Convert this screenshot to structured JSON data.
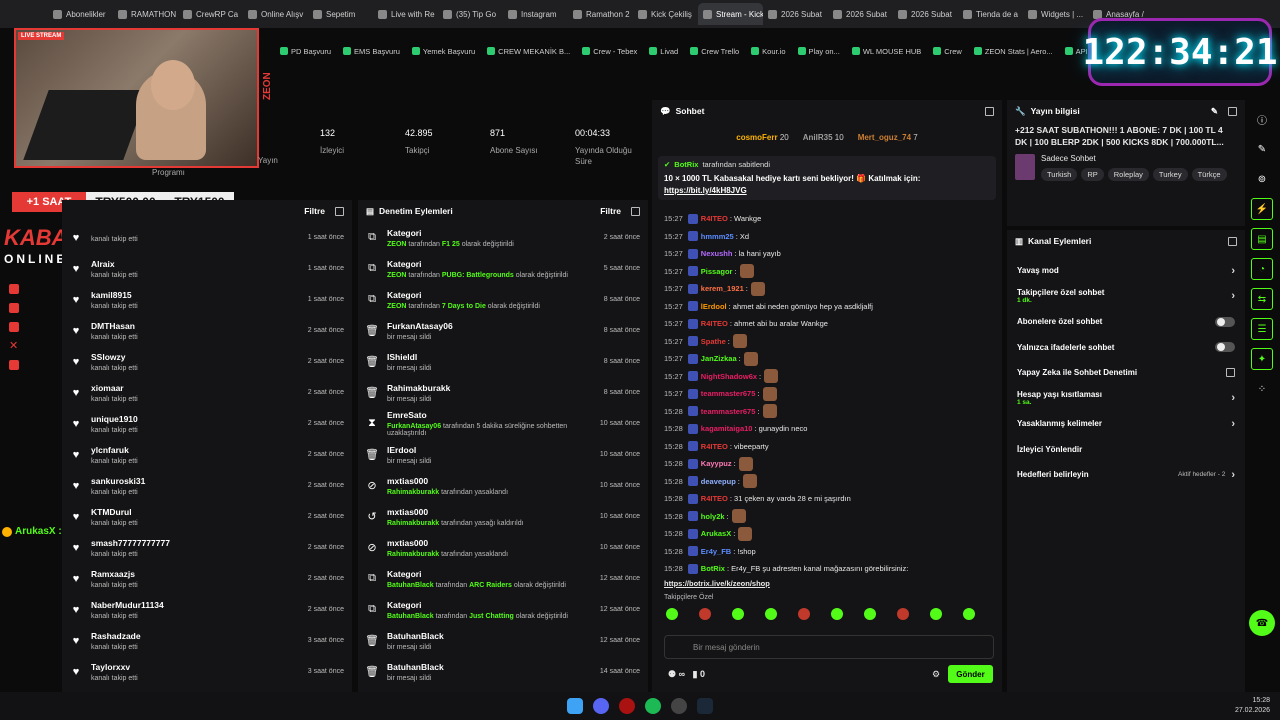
{
  "browser": {
    "tabs": [
      {
        "label": "Abonelikler",
        "active": false
      },
      {
        "label": "RAMATHON",
        "active": false
      },
      {
        "label": "CrewRP Ca",
        "active": false
      },
      {
        "label": "Online Alışv",
        "active": false
      },
      {
        "label": "Sepetim",
        "active": false
      },
      {
        "label": "Live with Re",
        "active": false
      },
      {
        "label": "(35) Tip Go",
        "active": false
      },
      {
        "label": "Instagram",
        "active": false
      },
      {
        "label": "Ramathon 2",
        "active": false
      },
      {
        "label": "Kick Çekiliş",
        "active": false
      },
      {
        "label": "Stream - Kick Dashb",
        "active": true
      },
      {
        "label": "2026 Subat",
        "active": false
      },
      {
        "label": "2026 Subat",
        "active": false
      },
      {
        "label": "2026 Subat",
        "active": false
      },
      {
        "label": "Tienda de a",
        "active": false
      },
      {
        "label": "Widgets | ...",
        "active": false
      },
      {
        "label": "Anasayfa / ",
        "active": false
      }
    ]
  },
  "bookmarks": [
    "PD Başvuru",
    "EMS Başvuru",
    "Yemek Başvuru",
    "CREW MEKANİK B...",
    "Crew - Tebex",
    "Livad",
    "Crew Trello",
    "Kour.io",
    "Play on...",
    "WL MOUSE HUB",
    "Crew",
    "ZEON Stats | Aero...",
    "APIq"
  ],
  "overlay": {
    "timer": "122:34:21",
    "stream_badge": "LIVE STREAM",
    "zeon": "ZEON",
    "donation_left": "+1 SAAT",
    "donation_mid": "TRY500.00",
    "donation_right": "TRY1500",
    "brand": "KABASAKAL",
    "brand2": "ONLINE.COM",
    "float_user": "ArukasX :"
  },
  "stats": [
    {
      "value": "132",
      "label": "İzleyici"
    },
    {
      "value": "42.895",
      "label": "Takipçi"
    },
    {
      "value": "871",
      "label": "Abone Sayısı"
    },
    {
      "value": "00:04:33",
      "label": "Yayında Olduğu Süre"
    }
  ],
  "stats_left_labels": {
    "a": "Yayın",
    "b": "Programı"
  },
  "followers": {
    "title": "",
    "filter": "Filtre",
    "items": [
      {
        "name": "",
        "sub": "kanalı takip etti",
        "time": "1 saat önce"
      },
      {
        "name": "Alraix",
        "sub": "kanalı takip etti",
        "time": "1 saat önce"
      },
      {
        "name": "kamil8915",
        "sub": "kanalı takip etti",
        "time": "1 saat önce"
      },
      {
        "name": "DMTHasan",
        "sub": "kanalı takip etti",
        "time": "2 saat önce"
      },
      {
        "name": "SSlowzy",
        "sub": "kanalı takip etti",
        "time": "2 saat önce"
      },
      {
        "name": "xiomaar",
        "sub": "kanalı takip etti",
        "time": "2 saat önce"
      },
      {
        "name": "unique1910",
        "sub": "kanalı takip etti",
        "time": "2 saat önce"
      },
      {
        "name": "ylcnfaruk",
        "sub": "kanalı takip etti",
        "time": "2 saat önce"
      },
      {
        "name": "sankuroski31",
        "sub": "kanalı takip etti",
        "time": "2 saat önce"
      },
      {
        "name": "KTMDurul",
        "sub": "kanalı takip etti",
        "time": "2 saat önce"
      },
      {
        "name": "smash77777777777",
        "sub": "kanalı takip etti",
        "time": "2 saat önce"
      },
      {
        "name": "Ramxaazjs",
        "sub": "kanalı takip etti",
        "time": "2 saat önce"
      },
      {
        "name": "NaberMudur11134",
        "sub": "kanalı takip etti",
        "time": "2 saat önce"
      },
      {
        "name": "Rashadzade",
        "sub": "kanalı takip etti",
        "time": "3 saat önce"
      },
      {
        "name": "Taylorxxv",
        "sub": "kanalı takip etti",
        "time": "3 saat önce"
      }
    ]
  },
  "mod": {
    "title": "Denetim Eylemleri",
    "filter": "Filtre",
    "items": [
      {
        "icon": "⧉",
        "name": "Kategori",
        "actor": "ZEON",
        "mid": " tarafından ",
        "target": "F1 25",
        "tail": " olarak değiştirildi",
        "time": "2 saat önce"
      },
      {
        "icon": "⧉",
        "name": "Kategori",
        "actor": "ZEON",
        "mid": " tarafından ",
        "target": "PUBG: Battlegrounds",
        "tail": " olarak değiştirildi",
        "time": "5 saat önce"
      },
      {
        "icon": "⧉",
        "name": "Kategori",
        "actor": "ZEON",
        "mid": " tarafından ",
        "target": "7 Days to Die",
        "tail": " olarak değiştirildi",
        "time": "8 saat önce"
      },
      {
        "icon": "🗑",
        "name": "FurkanAtasay06",
        "actor": "",
        "mid": "bir mesajı sildi",
        "target": "",
        "tail": "",
        "time": "8 saat önce"
      },
      {
        "icon": "🗑",
        "name": "IShieldl",
        "actor": "",
        "mid": "bir mesajı sildi",
        "target": "",
        "tail": "",
        "time": "8 saat önce"
      },
      {
        "icon": "🗑",
        "name": "Rahimakburakk",
        "actor": "",
        "mid": "bir mesajı sildi",
        "target": "",
        "tail": "",
        "time": "8 saat önce"
      },
      {
        "icon": "⧗",
        "name": "EmreSato",
        "actor": "FurkanAtasay06",
        "mid": " tarafından 5 dakika süreliğine sohbetten uzaklaştırıldı",
        "target": "",
        "tail": "",
        "time": "10 saat önce"
      },
      {
        "icon": "🗑",
        "name": "lErdool",
        "actor": "",
        "mid": "bir mesajı sildi",
        "target": "",
        "tail": "",
        "time": "10 saat önce"
      },
      {
        "icon": "⊘",
        "name": "mxtias000",
        "actor": "Rahimakburakk",
        "mid": " tarafından yasaklandı",
        "target": "",
        "tail": "",
        "time": "10 saat önce"
      },
      {
        "icon": "↺",
        "name": "mxtias000",
        "actor": "Rahimakburakk",
        "mid": " tarafından yasağı kaldırıldı",
        "target": "",
        "tail": "",
        "time": "10 saat önce"
      },
      {
        "icon": "⊘",
        "name": "mxtias000",
        "actor": "Rahimakburakk",
        "mid": " tarafından yasaklandı",
        "target": "",
        "tail": "",
        "time": "10 saat önce"
      },
      {
        "icon": "⧉",
        "name": "Kategori",
        "actor": "BatuhanBlack",
        "mid": " tarafından ",
        "target": "ARC Raiders",
        "tail": " olarak değiştirildi",
        "time": "12 saat önce"
      },
      {
        "icon": "⧉",
        "name": "Kategori",
        "actor": "BatuhanBlack",
        "mid": " tarafından ",
        "target": "Just Chatting",
        "tail": " olarak değiştirildi",
        "time": "12 saat önce"
      },
      {
        "icon": "🗑",
        "name": "BatuhanBlack",
        "actor": "",
        "mid": "bir mesajı sildi",
        "target": "",
        "tail": "",
        "time": "12 saat önce"
      },
      {
        "icon": "🗑",
        "name": "BatuhanBlack",
        "actor": "",
        "mid": "bir mesajı sildi",
        "target": "",
        "tail": "",
        "time": "14 saat önce"
      }
    ]
  },
  "chat": {
    "title": "Sohbet",
    "top": [
      {
        "name": "cosmoFerr",
        "count": "20"
      },
      {
        "name": "AnilR35",
        "count": "10"
      },
      {
        "name": "Mert_oguz_74",
        "count": "7"
      }
    ],
    "pinned": {
      "by": "BotRix",
      "by_tail": " tarafından sabitlendi",
      "message": "10 × 1000 TL Kabasakal hediye kartı seni bekliyor! 🎁 Katılmak için:",
      "link": "https://bit.ly/4kH8JVG"
    },
    "messages": [
      {
        "time": "15:27",
        "user": "R4ITEO",
        "color": "#e53935",
        "text": ": Wankge"
      },
      {
        "time": "15:27",
        "user": "hmmm25",
        "color": "#5b8cff",
        "text": ": Xd"
      },
      {
        "time": "15:27",
        "user": "Nexushh",
        "color": "#b46bff",
        "text": ": la hani yayıb"
      },
      {
        "time": "15:27",
        "user": "Pissagor",
        "color": "#53fc18",
        "text": ":"
      },
      {
        "time": "15:27",
        "user": "kerem_1921",
        "color": "#ff7043",
        "text": ":"
      },
      {
        "time": "15:27",
        "user": "lErdool",
        "color": "#ff9800",
        "text": ": ahmet abi neden gömüyo hep ya asdkljalfj"
      },
      {
        "time": "15:27",
        "user": "R4ITEO",
        "color": "#e53935",
        "text": ": ahmet abi bu aralar Wankge"
      },
      {
        "time": "15:27",
        "user": "Spathe",
        "color": "#e53935",
        "text": ":"
      },
      {
        "time": "15:27",
        "user": "JanZizkaa",
        "color": "#53fc18",
        "text": ":"
      },
      {
        "time": "15:27",
        "user": "NightShadow6x",
        "color": "#e91e63",
        "text": ":"
      },
      {
        "time": "15:27",
        "user": "teammaster675",
        "color": "#e91e63",
        "text": ":"
      },
      {
        "time": "15:28",
        "user": "teammaster675",
        "color": "#e91e63",
        "text": ":"
      },
      {
        "time": "15:28",
        "user": "kagamitaiga10",
        "color": "#e91e63",
        "text": ": gunaydin neco"
      },
      {
        "time": "15:28",
        "user": "R4ITEO",
        "color": "#e53935",
        "text": ": vibeeparty"
      },
      {
        "time": "15:28",
        "user": "Kayypuz",
        "color": "#ff7ab6",
        "text": ":"
      },
      {
        "time": "15:28",
        "user": "deavepup",
        "color": "#8fb0ff",
        "text": ":"
      },
      {
        "time": "15:28",
        "user": "R4ITEO",
        "color": "#e53935",
        "text": ": 31 çeken ay varda 28 e mi şaşırdın"
      },
      {
        "time": "15:28",
        "user": "holy2k",
        "color": "#53fc18",
        "text": ":"
      },
      {
        "time": "15:28",
        "user": "ArukasX",
        "color": "#53fc18",
        "text": ":"
      },
      {
        "time": "15:28",
        "user": "Er4y_FB",
        "color": "#5b8cff",
        "text": ": !shop"
      },
      {
        "time": "15:28",
        "user": "BotRix",
        "color": "#53fc18",
        "text": ": Er4y_FB şu adresten kanal mağazasını görebilirsiniz:"
      }
    ],
    "last_link": "https://botrix.live/k/zeon/shop",
    "followers_only": "Takipçilere Özel",
    "input_placeholder": "Bir mesaj gönderin",
    "points": "0",
    "send": "Gönder"
  },
  "info": {
    "title": "Yayın bilgisi",
    "stream_title": "+212 SAAT SUBATHON!!! 1 ABONE: 7 DK | 100 TL 4 DK | 100 BLERP 2DK | 500 KICKS 8DK | 700.000TL...",
    "category": "Sadece Sohbet",
    "tags": [
      "Turkish",
      "RP",
      "Roleplay",
      "Turkey",
      "Türkçe"
    ]
  },
  "actions": {
    "title": "Kanal Eylemleri",
    "items": [
      {
        "label": "Yavaş mod",
        "sub": "",
        "kind": "chevron"
      },
      {
        "label": "Takipçilere özel sohbet",
        "sub": "1 dk.",
        "kind": "chevron"
      },
      {
        "label": "Abonelere özel sohbet",
        "sub": "",
        "kind": "toggle"
      },
      {
        "label": "Yalnızca ifadelerle sohbet",
        "sub": "",
        "kind": "toggle"
      },
      {
        "label": "Yapay Zeka ile Sohbet Denetimi",
        "sub": "",
        "kind": "external"
      },
      {
        "label": "Hesap yaşı kısıtlaması",
        "sub": "1 sa.",
        "kind": "chevron"
      },
      {
        "label": "Yasaklanmış kelimeler",
        "sub": "",
        "kind": "chevron"
      },
      {
        "label": "İzleyici Yönlendir",
        "sub": "",
        "kind": "none"
      },
      {
        "label": "Hedefleri belirleyin",
        "sub": "",
        "kind": "goal",
        "extra": "Aktif hedefler - 2"
      }
    ]
  },
  "clock": {
    "time": "15:28",
    "date": "27.02.2026"
  },
  "colors": {
    "kick_green": "#53fc18",
    "accent_red": "#e53935",
    "panel": "#141416"
  }
}
